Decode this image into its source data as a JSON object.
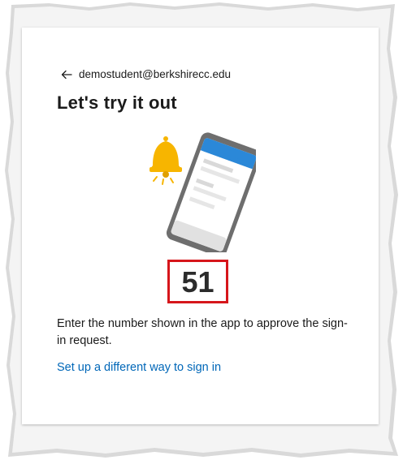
{
  "account": {
    "email": "demostudent@berkshirecc.edu"
  },
  "page": {
    "title": "Let's try it out"
  },
  "verification": {
    "number": "51",
    "instructions": "Enter the number shown in the app to approve the sign-in request."
  },
  "links": {
    "alternate_method": "Set up a different way to sign in"
  },
  "colors": {
    "bell": "#f7b500",
    "phone_header": "#2b88d8",
    "highlight_border": "#d6161b",
    "link": "#0067b8"
  },
  "icons": {
    "back": "arrow-left-icon",
    "bell": "bell-icon",
    "phone": "phone-illustration"
  }
}
